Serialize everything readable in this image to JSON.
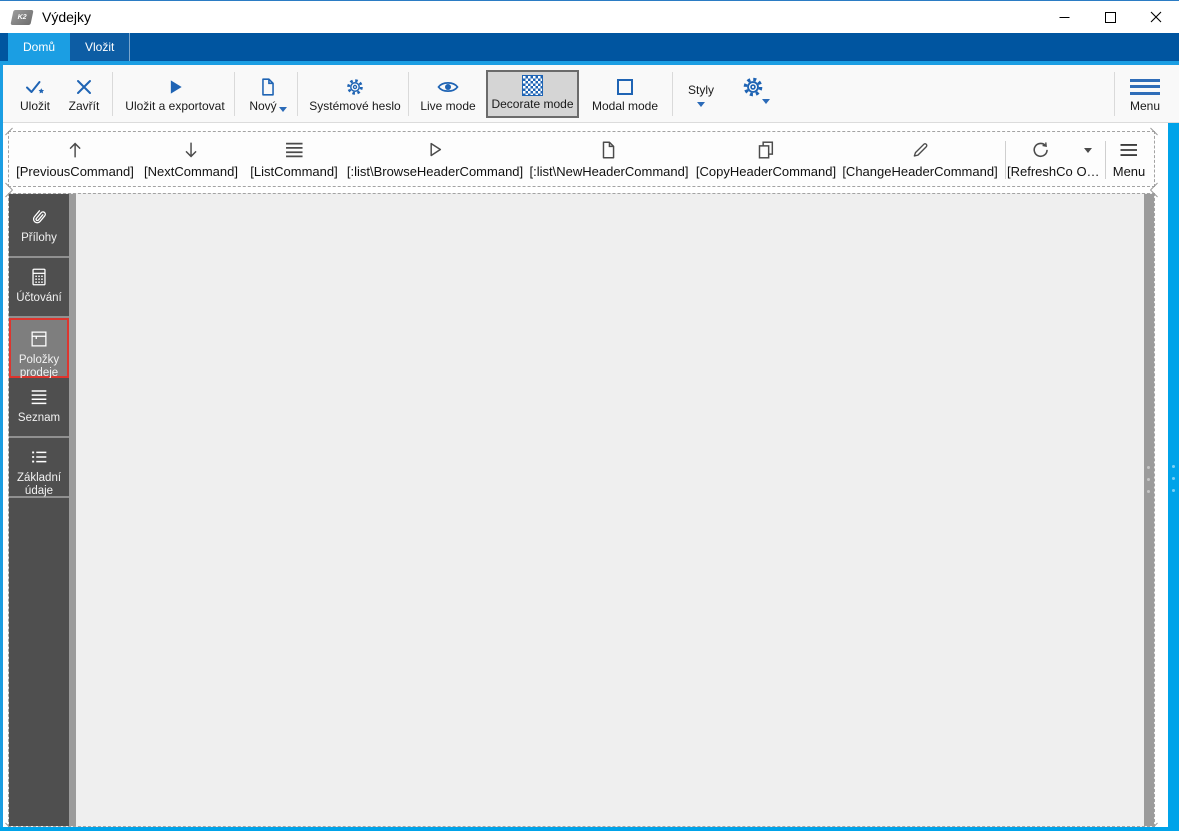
{
  "window": {
    "title": "Výdejky",
    "app_icon_text": "K2"
  },
  "tabs": [
    {
      "label": "Domů",
      "active": true
    },
    {
      "label": "Vložit",
      "active": false
    }
  ],
  "ribbon": {
    "save": "Uložit",
    "close": "Zavřít",
    "save_export": "Uložit a exportovat",
    "new": "Nový",
    "system_password": "Systémové heslo",
    "live_mode": "Live mode",
    "decorate_mode": "Decorate mode",
    "modal_mode": "Modal mode",
    "styles": "Styly",
    "menu": "Menu"
  },
  "command_bar": {
    "previous": "[PreviousCommand]",
    "next": "[NextCommand]",
    "list": "[ListCommand]",
    "browse_header": "[:list\\BrowseHeaderCommand]",
    "new_header": "[:list\\NewHeaderCommand]",
    "copy_header": "[CopyHeaderCommand]",
    "change_header": "[ChangeHeaderCommand]",
    "refresh_truncated": "[RefreshCo",
    "overflow_truncated": "O…",
    "menu": "Menu"
  },
  "sidebar": {
    "items": [
      {
        "label": "Přílohy",
        "selected": false
      },
      {
        "label": "Účtování",
        "selected": false
      },
      {
        "label": "Položky prodeje",
        "selected": true
      },
      {
        "label": "Seznam",
        "selected": false
      },
      {
        "label": "Základní údaje",
        "selected": false
      }
    ]
  },
  "colors": {
    "tab_bar_blue": "#0055a0",
    "accent_light_blue": "#1b9ee3",
    "ribbon_icon_blue": "#1f64b4",
    "designer_edge_blue": "#00a3e9",
    "sidebar_bg": "#4f4f4f",
    "sidebar_selected_bg": "#7e7e7e",
    "selection_red": "#dd352e",
    "content_bg": "#efefef"
  }
}
